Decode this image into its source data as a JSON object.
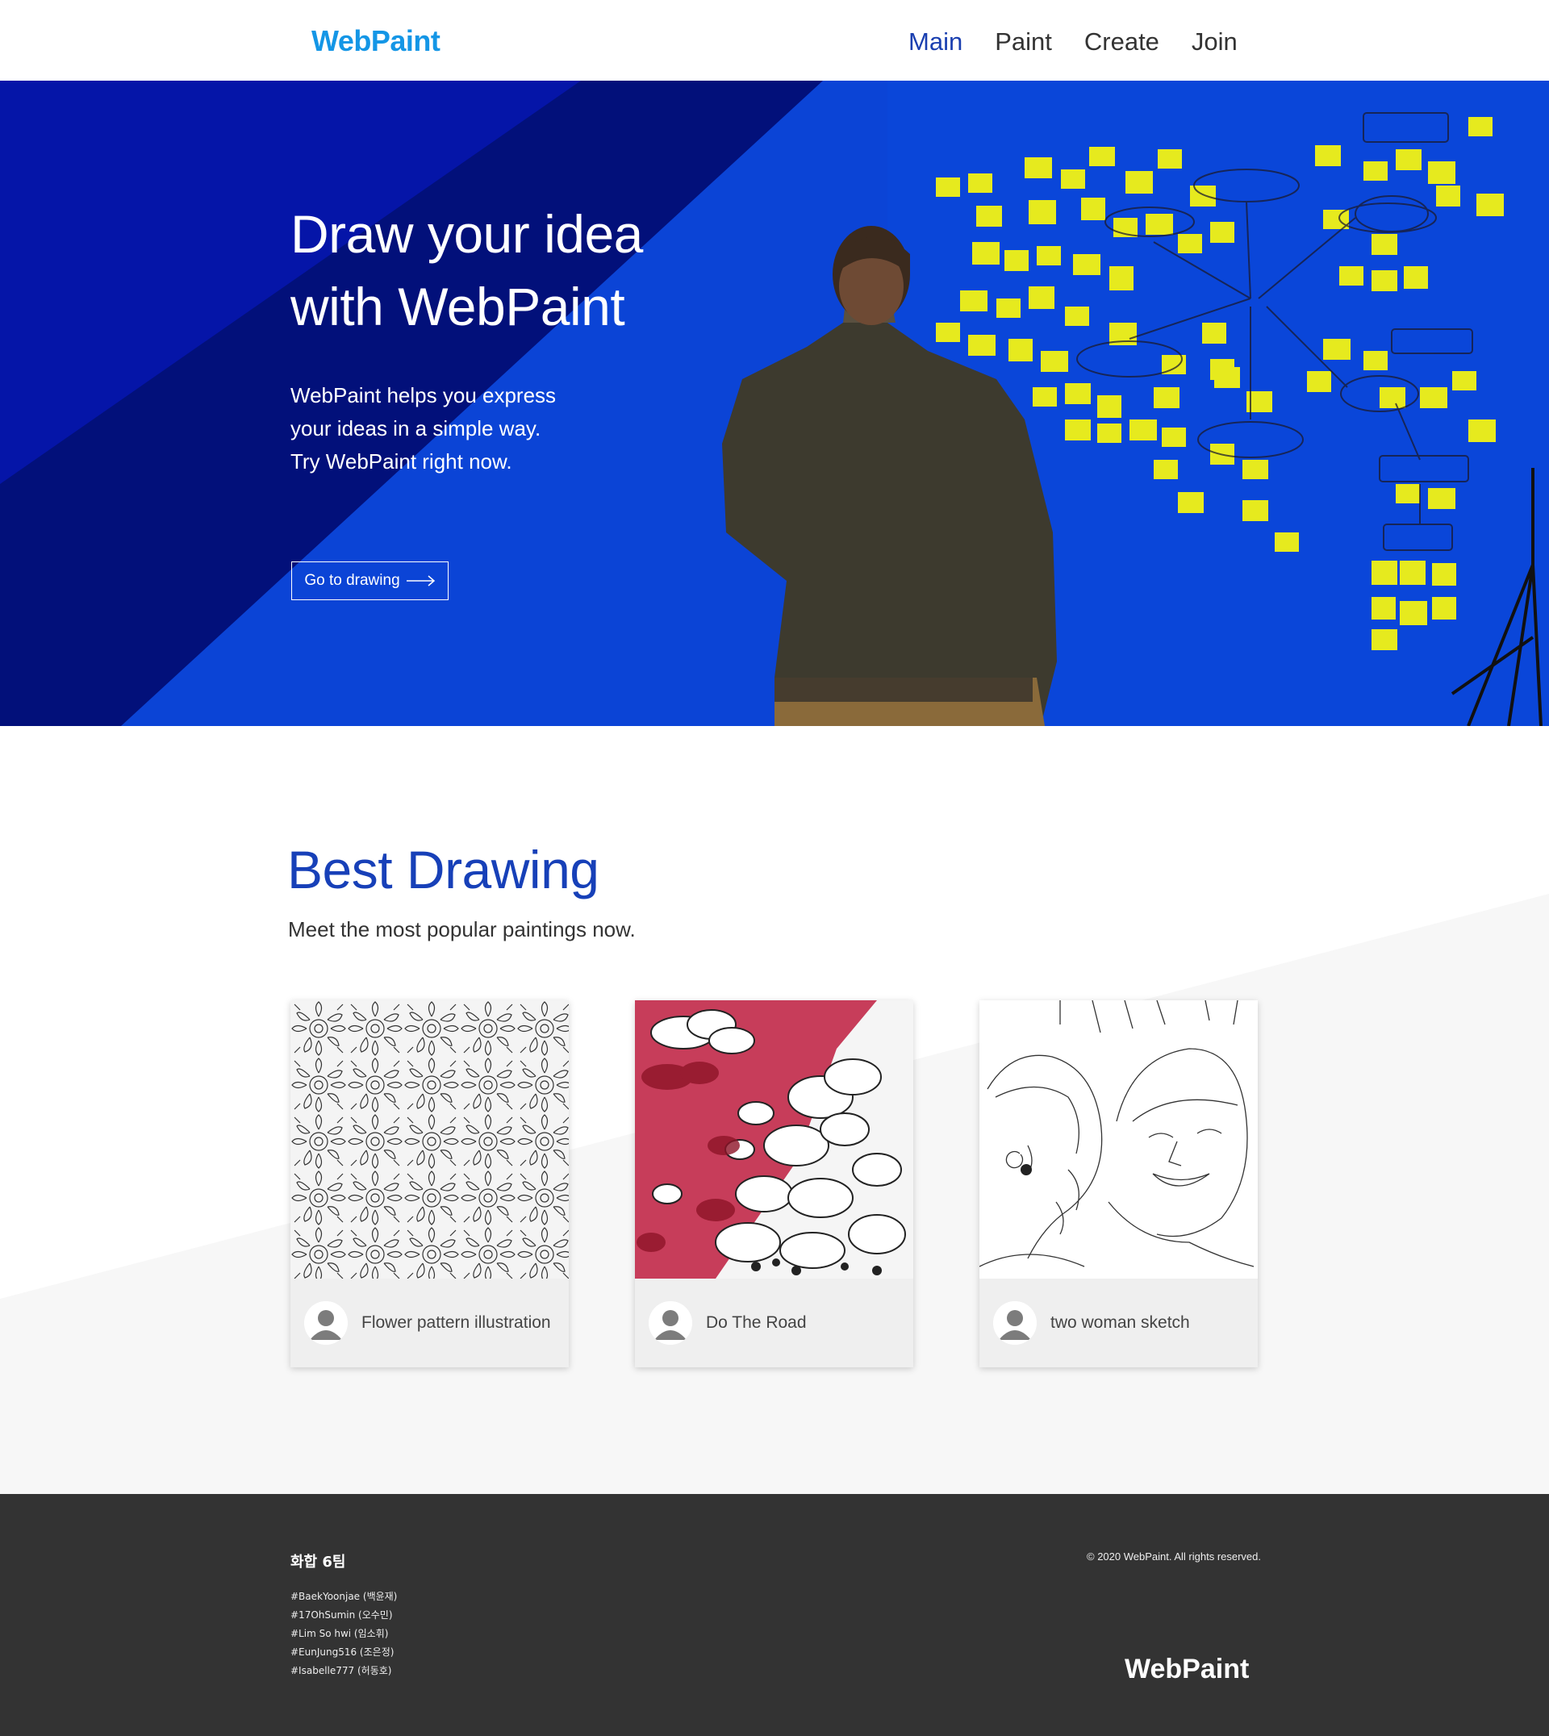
{
  "header": {
    "logo": "WebPaint",
    "nav": [
      "Main",
      "Paint",
      "Create",
      "Join"
    ]
  },
  "hero": {
    "title_line1": "Draw your idea",
    "title_line2": "with WebPaint",
    "desc_line1": "WebPaint helps you express",
    "desc_line2": "your ideas in a simple way.",
    "desc_line3": "Try WebPaint right now.",
    "button": "Go to drawing"
  },
  "best": {
    "title": "Best Drawing",
    "subtitle": "Meet the most popular paintings now.",
    "cards": [
      {
        "title": "Flower pattern illustration",
        "image": "flower-pattern"
      },
      {
        "title": "Do The Road",
        "image": "cloud-mural"
      },
      {
        "title": "two woman sketch",
        "image": "portrait-sketch"
      }
    ]
  },
  "footer": {
    "team": "화합 6팀",
    "members": [
      "#BaekYoonjae (백윤재)",
      "#17OhSumin (오수민)",
      "#Lim So hwi (임소휘)",
      "#EunJung516 (조은정)",
      "#Isabelle777 (허동호)"
    ],
    "copyright": "© 2020 WebPaint. All rights reserved.",
    "logo": "WebPaint"
  },
  "colors": {
    "brand": "#1496e6",
    "accent": "#1740b8",
    "hero_blue": "#0a45d8",
    "footer_bg": "#333333"
  }
}
